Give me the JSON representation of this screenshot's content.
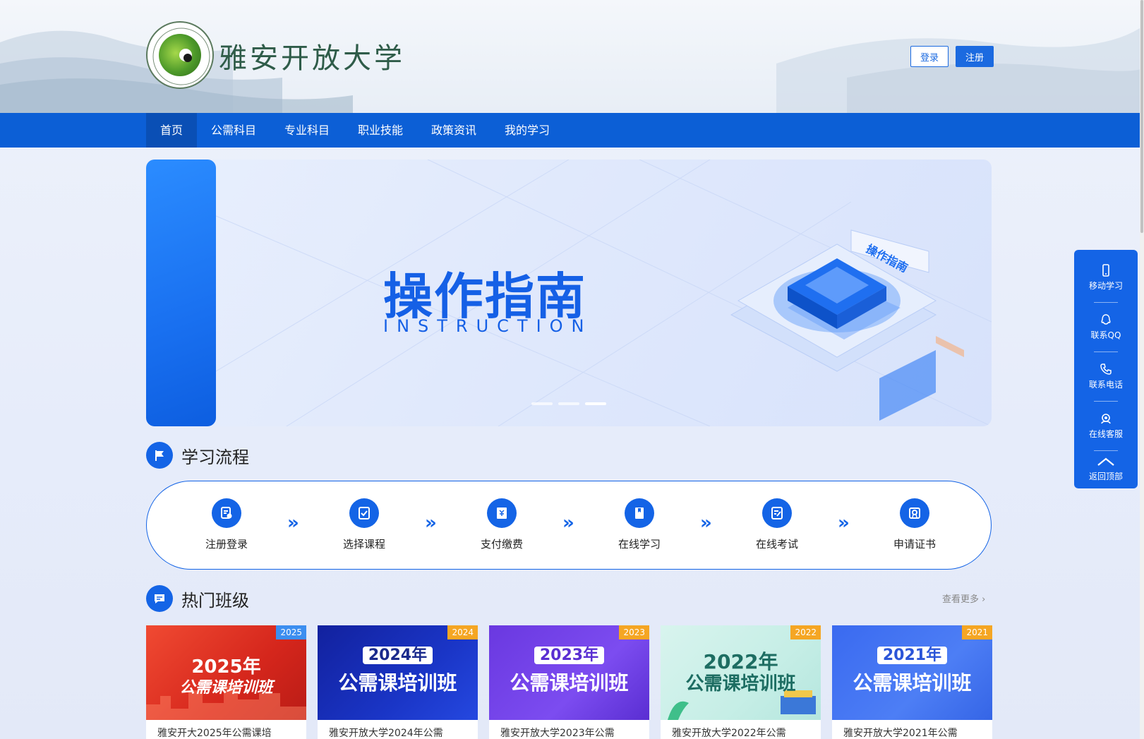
{
  "header": {
    "school_name": "雅安开放大学",
    "login_label": "登录",
    "register_label": "注册"
  },
  "nav": {
    "items": [
      {
        "label": "首页",
        "active": true
      },
      {
        "label": "公需科目"
      },
      {
        "label": "专业科目"
      },
      {
        "label": "职业技能"
      },
      {
        "label": "政策资讯"
      },
      {
        "label": "我的学习"
      }
    ]
  },
  "banner": {
    "title": "操作指南",
    "subtitle": "INSTRUCTION",
    "tag": "操作指南",
    "slides": 3,
    "active_slide": 3
  },
  "process": {
    "title": "学习流程",
    "steps": [
      {
        "label": "注册登录",
        "icon": "register-login-icon"
      },
      {
        "label": "选择课程",
        "icon": "select-course-icon"
      },
      {
        "label": "支付缴费",
        "icon": "payment-icon"
      },
      {
        "label": "在线学习",
        "icon": "online-study-icon"
      },
      {
        "label": "在线考试",
        "icon": "online-exam-icon"
      },
      {
        "label": "申请证书",
        "icon": "certificate-icon"
      }
    ],
    "arrow": "»"
  },
  "hot": {
    "title": "热门班级",
    "more_label": "查看更多",
    "cards": [
      {
        "badge": "2025",
        "year": "2025年",
        "name": "公需课培训班",
        "title": "雅安开大2025年公需课培"
      },
      {
        "badge": "2024",
        "year": "2024年",
        "name": "公需课培训班",
        "title": "雅安开放大学2024年公需"
      },
      {
        "badge": "2023",
        "year": "2023年",
        "name": "公需课培训班",
        "title": "雅安开放大学2023年公需"
      },
      {
        "badge": "2022",
        "year": "2022年",
        "name": "公需课培训班",
        "title": "雅安开放大学2022年公需"
      },
      {
        "badge": "2021",
        "year": "2021年",
        "name": "公需课培训班",
        "title": "雅安开放大学2021年公需"
      }
    ]
  },
  "sidebar": {
    "items": [
      {
        "label": "移动学习",
        "icon": "mobile-icon"
      },
      {
        "label": "联系QQ",
        "icon": "qq-icon"
      },
      {
        "label": "联系电话",
        "icon": "phone-icon"
      },
      {
        "label": "在线客服",
        "icon": "customer-service-icon"
      },
      {
        "label": "返回顶部",
        "icon": "back-to-top-icon"
      }
    ]
  },
  "colors": {
    "primary": "#1464e6",
    "nav": "#0c5fd6",
    "nav_active": "#0a4fb5",
    "school_name": "#2f5c49"
  }
}
